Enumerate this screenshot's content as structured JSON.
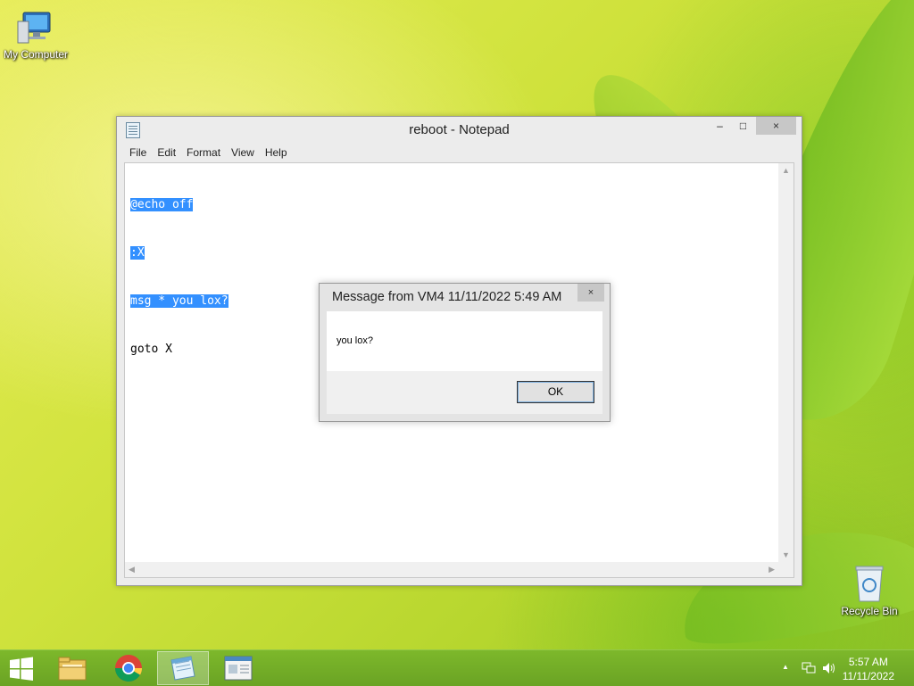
{
  "desktop": {
    "icons": [
      {
        "label": "My Computer"
      },
      {
        "label": "Recycle Bin"
      }
    ]
  },
  "notepad": {
    "title": "reboot - Notepad",
    "controls": {
      "minimize": "–",
      "maximize": "□",
      "close": "×"
    },
    "menu": [
      "File",
      "Edit",
      "Format",
      "View",
      "Help"
    ],
    "lines": [
      {
        "text": "@echo off",
        "selected": true
      },
      {
        "text": ":X",
        "selected": true
      },
      {
        "text": "msg * you lox?",
        "selected": true
      },
      {
        "text": "goto X",
        "selected": false
      }
    ]
  },
  "message_box": {
    "title": "Message from VM4 11/11/2022 5:49 AM",
    "close": "×",
    "text": "you lox?",
    "ok_label": "OK"
  },
  "taskbar": {
    "apps": [
      "start-icon",
      "file-explorer-icon",
      "chrome-icon",
      "notepad-icon",
      "message-window-icon"
    ],
    "tray": {
      "chevron": "▲",
      "time": "5:57 AM",
      "date": "11/11/2022"
    }
  },
  "colors": {
    "selection": "#3390ff",
    "taskbar": "#6aa324"
  }
}
